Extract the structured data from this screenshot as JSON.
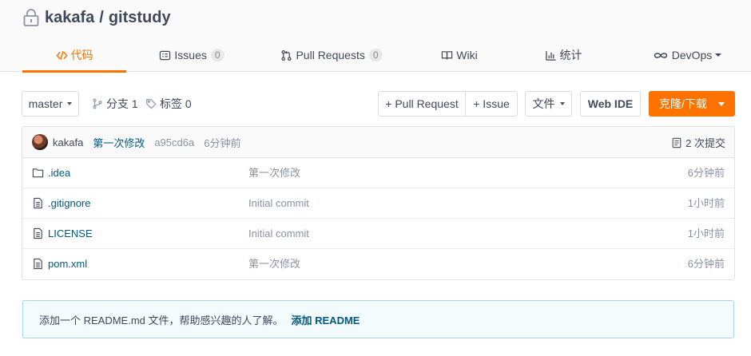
{
  "repo": {
    "owner": "kakafa",
    "separator": "/",
    "name": "gitstudy"
  },
  "tabs": [
    {
      "label": "代码",
      "icon": "code-icon",
      "active": true
    },
    {
      "label": "Issues",
      "icon": "issues-icon",
      "count": "0"
    },
    {
      "label": "Pull Requests",
      "icon": "pull-request-icon",
      "count": "0"
    },
    {
      "label": "Wiki",
      "icon": "wiki-icon"
    },
    {
      "label": "统计",
      "icon": "stats-icon"
    },
    {
      "label": "DevOps",
      "icon": "devops-icon"
    }
  ],
  "toolbar": {
    "branch": "master",
    "branches_label": "分支 1",
    "tags_label": "标签 0",
    "new_pr": "+ Pull Request",
    "new_issue": "+ Issue",
    "file_menu": "文件",
    "web_ide": "Web IDE",
    "clone": "克隆/下载"
  },
  "last_commit": {
    "author": "kakafa",
    "message": "第一次修改",
    "sha": "a95cd6a",
    "time": "6分钟前",
    "commit_count": "2 次提交"
  },
  "files": [
    {
      "name": ".idea",
      "type": "folder",
      "message": "第一次修改",
      "time": "6分钟前"
    },
    {
      "name": ".gitignore",
      "type": "file",
      "message": "Initial commit",
      "time": "1小时前"
    },
    {
      "name": "LICENSE",
      "type": "file",
      "message": "Initial commit",
      "time": "1小时前"
    },
    {
      "name": "pom.xml",
      "type": "file",
      "message": "第一次修改",
      "time": "6分钟前"
    }
  ],
  "readme_notice": {
    "text": "添加一个 README.md 文件，帮助感兴趣的人了解。",
    "action": "添加 README"
  },
  "colors": {
    "accent": "#fe7300",
    "link": "#005980",
    "muted": "#8c92a4",
    "text": "#40485b"
  }
}
